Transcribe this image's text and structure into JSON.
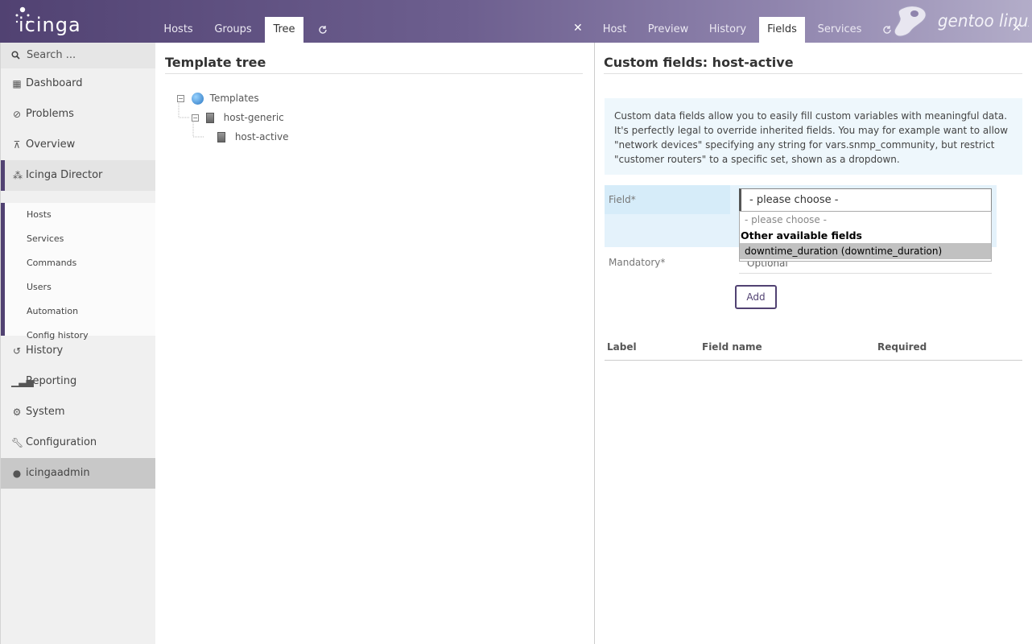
{
  "header": {
    "logo_text": "icinga",
    "left_tabs": [
      "Hosts",
      "Groups",
      "Tree"
    ],
    "left_active_tab": "Tree",
    "refresh_icon": "refresh-icon",
    "close_icon": "close-icon",
    "right_tabs": [
      "Host",
      "Preview",
      "History",
      "Fields",
      "Services"
    ],
    "right_active_tab": "Fields",
    "watermark": "gentoo linux"
  },
  "sidebar": {
    "search_placeholder": "Search ...",
    "items": [
      {
        "label": "Dashboard",
        "icon": "dashboard-icon"
      },
      {
        "label": "Problems",
        "icon": "problems-icon"
      },
      {
        "label": "Overview",
        "icon": "overview-icon"
      },
      {
        "label": "Icinga Director",
        "icon": "director-icon"
      },
      {
        "label": "History",
        "icon": "history-icon"
      },
      {
        "label": "Reporting",
        "icon": "reporting-icon"
      },
      {
        "label": "System",
        "icon": "system-icon"
      },
      {
        "label": "Configuration",
        "icon": "wrench-icon"
      },
      {
        "label": "icingaadmin",
        "icon": "user-icon"
      }
    ],
    "director_subitems": [
      "Hosts",
      "Services",
      "Commands",
      "Users",
      "Automation",
      "Config history"
    ]
  },
  "left_panel": {
    "title": "Template tree",
    "tree": {
      "root": "Templates",
      "child": "host-generic",
      "grandchild": "host-active"
    }
  },
  "right_panel": {
    "title": "Custom fields: host-active",
    "hint": "Custom data fields allow you to easily fill custom variables with meaningful data. It's perfectly legal to override inherited fields. You may for example want to allow \"network devices\" specifying any string for vars.snmp_community, but restrict \"customer routers\" to a specific set, shown as a dropdown.",
    "field_label": "Field*",
    "field_value": "- please choose -",
    "dropdown": {
      "placeholder_option": "- please choose -",
      "group_label": "Other available fields",
      "options": [
        "downtime_duration (downtime_duration)"
      ],
      "highlighted": "downtime_duration (downtime_duration)"
    },
    "mandatory_label": "Mandatory*",
    "mandatory_value": "Optional",
    "add_button": "Add",
    "table_headers": [
      "Label",
      "Field name",
      "Required"
    ]
  },
  "colors": {
    "brand": "#514272",
    "info_bg": "#eef7fc",
    "form_highlight": "#e4f2fb"
  }
}
